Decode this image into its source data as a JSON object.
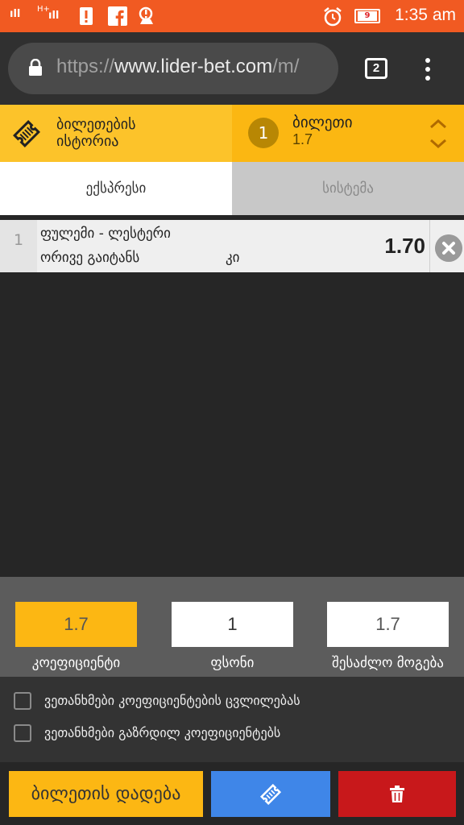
{
  "status_bar": {
    "time": "1:35 am",
    "signal1": "ıll",
    "signal2": "H+",
    "battery_level": "9"
  },
  "browser": {
    "url_scheme": "https://",
    "url_host": "www.lider-bet.com",
    "url_path": "/m/",
    "tab_count": "2"
  },
  "header": {
    "history_line1": "ბილეთების",
    "history_line2": "ისტორია",
    "current_count": "1",
    "current_label": "ბილეთი",
    "current_odds": "1.7"
  },
  "tabs": {
    "express": "ექსპრესი",
    "system": "სისტემა"
  },
  "bet": {
    "number": "1",
    "match": "ფულემი - ლესტერი",
    "outcome": "ორივე გაიტანს",
    "answer": "კი",
    "odds": "1.70"
  },
  "summary": {
    "coefficient_value": "1.7",
    "coefficient_label": "კოეფიციენტი",
    "stake_value": "1",
    "stake_label": "ფსონი",
    "win_value": "1.7",
    "win_label": "შესაძლო მოგება"
  },
  "agreements": {
    "accept_changes": "ვეთანხმები კოეფიციენტების ცვლილებას",
    "accept_increase": "ვეთანხმები გაზრდილ კოეფიციენტებს"
  },
  "actions": {
    "place_bet": "ბილეთის დადება"
  },
  "colors": {
    "accent_yellow": "#fbb712",
    "primary_blue": "#3f86e8",
    "danger_red": "#c8181b",
    "status_orange": "#f15a22"
  },
  "icons": {
    "ticket": "ticket-icon",
    "chevrons": "up-down-chevron-icon",
    "remove": "close-circle-icon",
    "trash": "trash-icon"
  }
}
